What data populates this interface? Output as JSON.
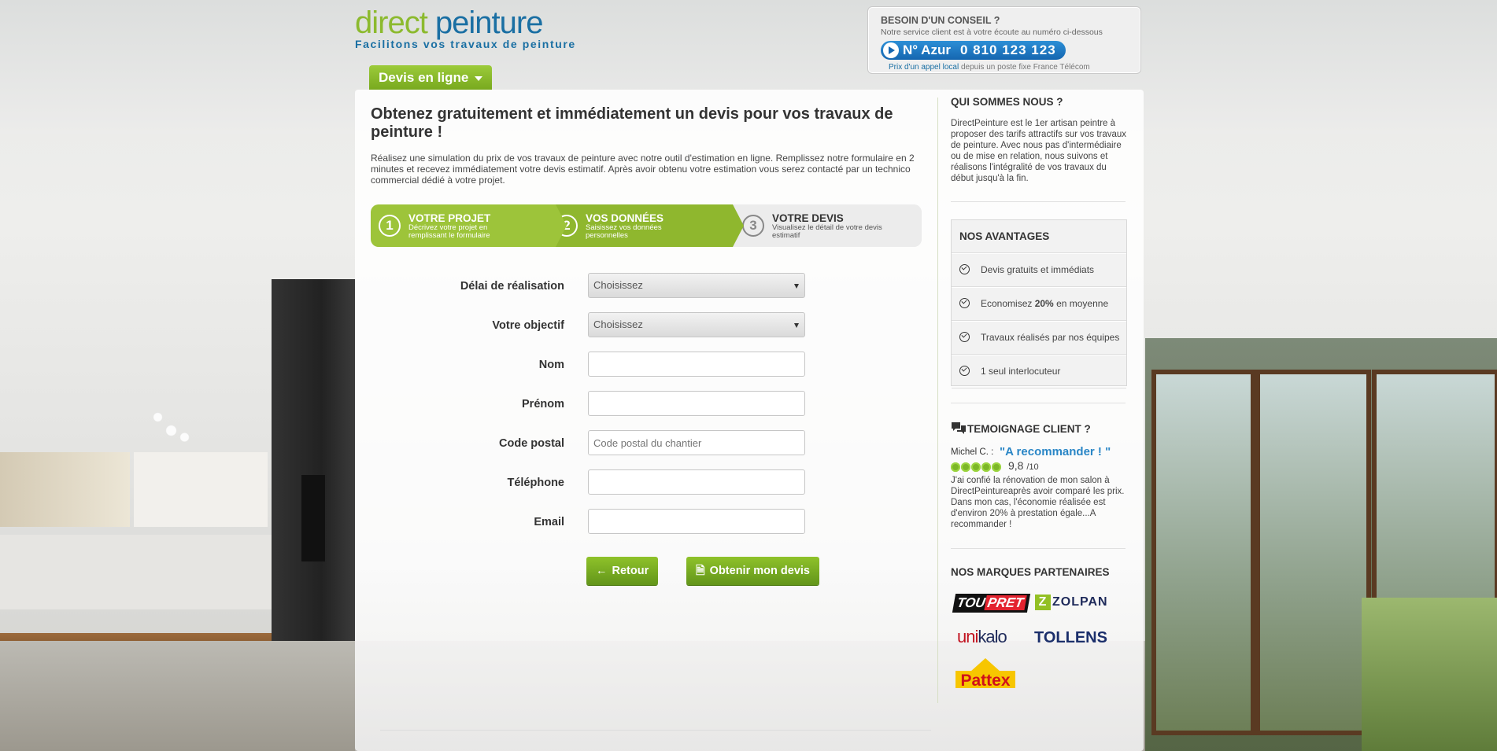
{
  "header": {
    "logo_part1": "direct",
    "logo_part2": " peinture",
    "tagline": "Facilitons vos travaux de peinture"
  },
  "advice": {
    "title": "BESOIN D'UN CONSEIL ?",
    "subtitle": "Notre service client est à votre écoute au numéro ci-dessous",
    "azur_label": "N° Azur",
    "phone_number": "0 810 123 123",
    "note_link": "Prix d'un appel local",
    "note_rest": " depuis un poste fixe France Télécom"
  },
  "nav": {
    "tab_label": "Devis en ligne"
  },
  "main": {
    "title": "Obtenez gratuitement et immédiatement un devis pour vos travaux de peinture !",
    "intro": "Réalisez une simulation du prix de vos travaux de peinture avec notre outil d'estimation en ligne. Remplissez notre formulaire en 2 minutes et recevez immédiatement votre devis estimatif. Après avoir obtenu votre estimation vous serez contacté par un technico commercial dédié à votre projet.",
    "steps": [
      {
        "num": "1",
        "title": "VOTRE PROJET",
        "desc": "Décrivez votre projet en remplissant le formulaire"
      },
      {
        "num": "2",
        "title": "VOS DONNÉES",
        "desc": "Saisissez vos données personnelles"
      },
      {
        "num": "3",
        "title": "VOTRE DEVIS",
        "desc": "Visualisez le détail de votre devis estimatif"
      }
    ],
    "form": {
      "delai_label": "Délai de réalisation",
      "delai_value": "Choisissez",
      "objectif_label": "Votre objectif",
      "objectif_value": "Choisissez",
      "nom_label": "Nom",
      "prenom_label": "Prénom",
      "cp_label": "Code postal",
      "cp_placeholder": "Code postal du chantier",
      "tel_label": "Téléphone",
      "email_label": "Email"
    },
    "buttons": {
      "back_label": "Retour",
      "submit_label": "Obtenir mon devis"
    }
  },
  "sidebar": {
    "about_title": "QUI SOMMES NOUS ?",
    "about_text": "DirectPeinture est le 1er artisan peintre à proposer des tarifs attractifs sur vos travaux de peinture. Avec nous pas d'intermédiaire ou de mise en relation, nous suivons et réalisons l'intégralité de vos travaux du début jusqu'à la fin.",
    "advantages_title": "NOS AVANTAGES",
    "advantages": [
      {
        "text": "Devis gratuits et immédiats"
      },
      {
        "text_before": "Economisez ",
        "bold": "20%",
        "text_after": " en moyenne"
      },
      {
        "text": "Travaux réalisés par nos équipes"
      },
      {
        "text": "1 seul interlocuteur"
      }
    ],
    "testimonial_title": "TEMOIGNAGE CLIENT ?",
    "testimonial_author": "Michel C. :",
    "testimonial_quote": "\"A recommander ! \"",
    "rating_value": "9,8",
    "rating_max": "/10",
    "rating_stars": 5,
    "testimonial_text": "J'ai confié la rénovation de mon salon à DirectPeintureaprès avoir comparé les prix. Dans mon cas, l'économie réalisée est d'environ 20% à prestation égale...A recommander !",
    "partners_title": "NOS MARQUES PARTENAIRES",
    "partners": {
      "toupret_a": "TOU",
      "toupret_b": "PRET",
      "zolpan": "ZOLPAN",
      "unikalo_a": "uni",
      "unikalo_b": "kalo",
      "tollens": "TOLLENS",
      "pattex": "Pattex"
    }
  },
  "colors": {
    "brand_green": "#8cba2e",
    "brand_blue": "#1a6fa3",
    "button_green": "#62951a",
    "quote_blue": "#2a86c6"
  }
}
